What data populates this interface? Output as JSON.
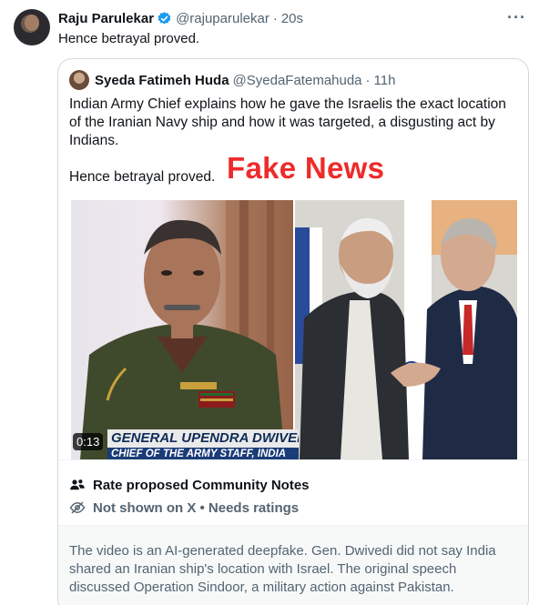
{
  "tweet": {
    "author_name": "Raju Parulekar",
    "handle": "@rajuparulekar",
    "separator": "·",
    "time": "20s",
    "text": "Hence betrayal proved.",
    "more_icon": "more-horizontal-icon"
  },
  "quoted": {
    "author_name": "Syeda Fatimeh Huda",
    "handle": "@SyedaFatemahuda",
    "separator": "·",
    "time": "11h",
    "text": "Indian Army Chief explains how he gave the Israelis the exact location of the Iranian Navy ship and how it was targeted, a disgusting act by Indians.",
    "text2": "Hence betrayal proved.",
    "overlay_label": "Fake News",
    "media": {
      "timer": "0:13",
      "lower_third_line1": "GENERAL UPENDRA DWIVEDI,",
      "lower_third_line2": "CHIEF OF THE ARMY STAFF, INDIA"
    }
  },
  "community_notes": {
    "rate_label": "Rate proposed Community Notes",
    "status_label": "Not shown on X • Needs ratings",
    "note_text": "The video is an AI-generated deepfake. Gen. Dwivedi did not say India shared an Iranian ship's location with Israel. The original speech discussed Operation Sindoor, a military action against Pakistan."
  },
  "colors": {
    "verified_blue": "#1d9bf0",
    "fake_news_red": "#ee2b2b",
    "secondary_text": "#536471"
  }
}
